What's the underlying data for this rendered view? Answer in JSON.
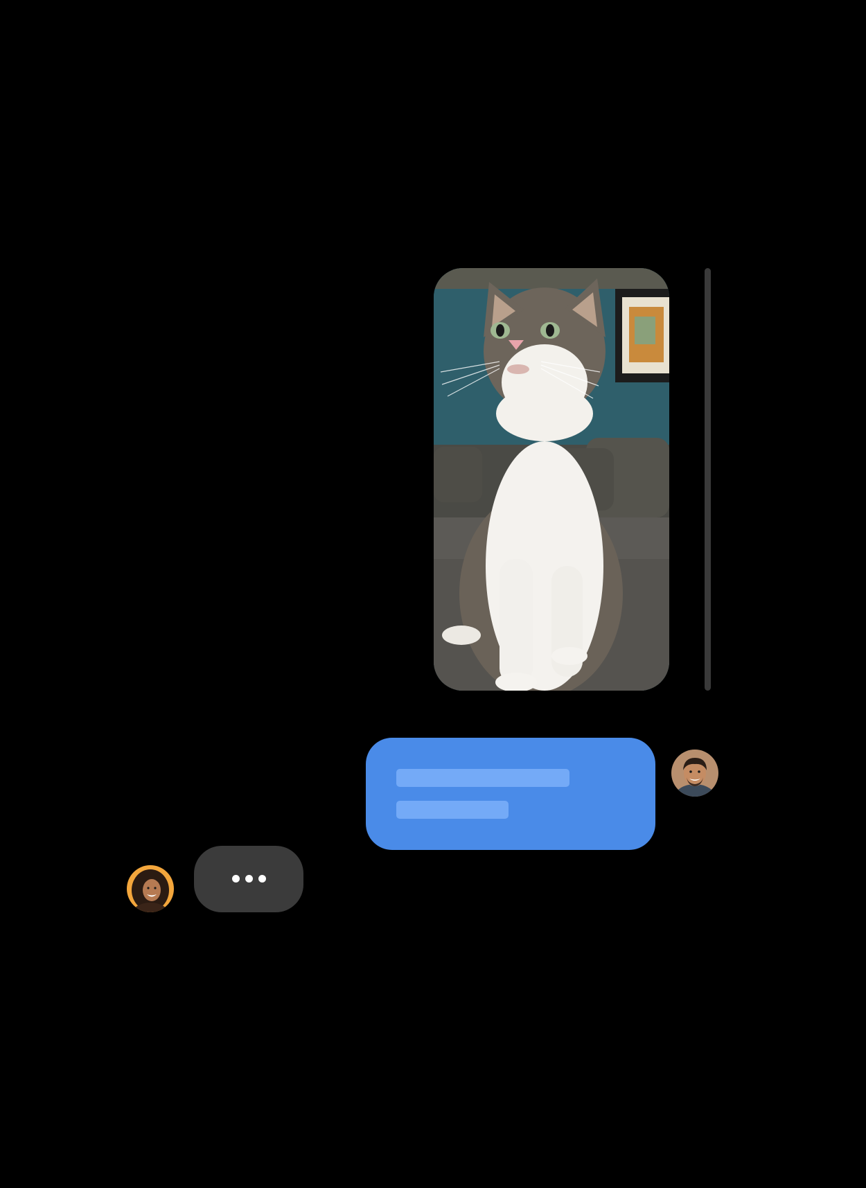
{
  "conversation": {
    "messages": [
      {
        "id": "image-message",
        "kind": "image",
        "sender": "self",
        "image_subject": "tabby-and-white-cat-photo"
      },
      {
        "id": "outgoing-text-message",
        "kind": "text-placeholder",
        "sender": "self",
        "placeholder_lines": 2
      },
      {
        "id": "typing-indicator",
        "kind": "typing",
        "sender": "other"
      }
    ],
    "participants": {
      "self": {
        "avatar_icon": "man-avatar"
      },
      "other": {
        "avatar_icon": "woman-avatar"
      }
    }
  },
  "colors": {
    "background": "#000000",
    "outgoing_bubble": "#4a8be8",
    "placeholder_line": "#74aaf7",
    "typing_bubble": "#3b3b3b",
    "scroll_track": "#3a3a3a"
  }
}
